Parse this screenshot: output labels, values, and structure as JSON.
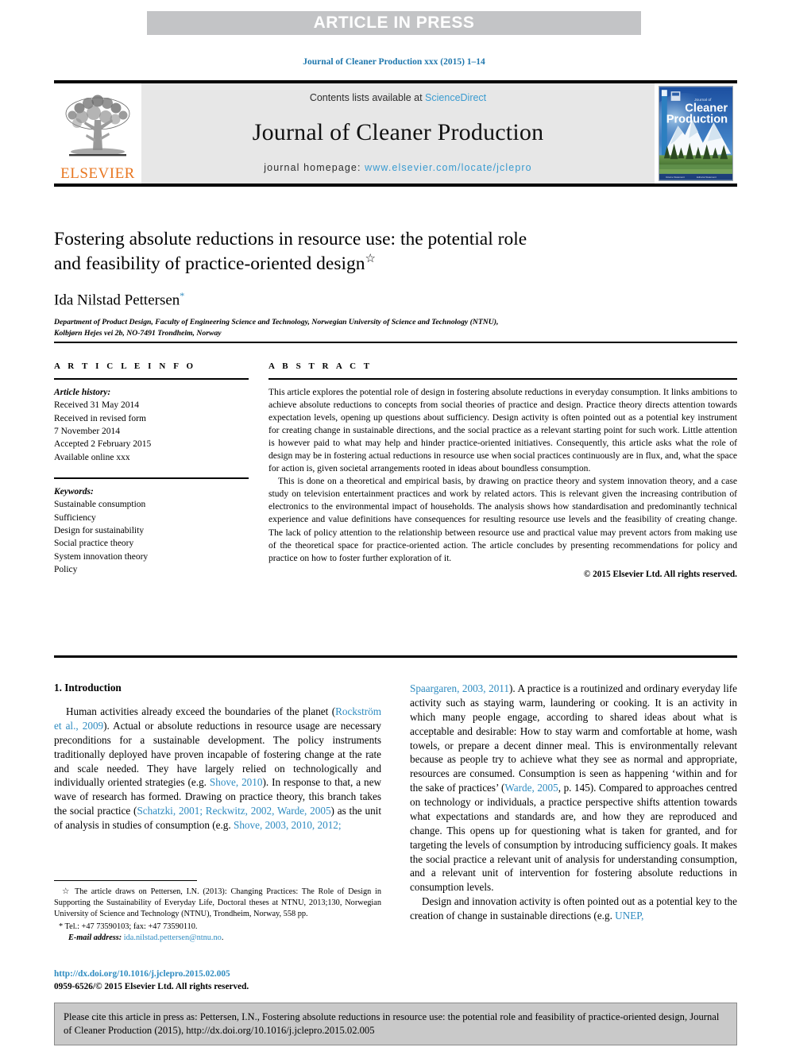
{
  "banner": {
    "label": "ARTICLE IN PRESS"
  },
  "journal_ref": "Journal of Cleaner Production xxx (2015) 1–14",
  "masthead": {
    "publisher_name": "ELSEVIER",
    "contents_prefix": "Contents lists available at ",
    "contents_link": "ScienceDirect",
    "journal_title": "Journal of Cleaner Production",
    "homepage_prefix": "journal homepage: ",
    "homepage_url": "www.elsevier.com/locate/jclepro",
    "cover": {
      "line1": "Journal of",
      "line2": "Cleaner",
      "line3": "Production"
    }
  },
  "title": {
    "line1": "Fostering absolute reductions in resource use: the potential role",
    "line2": "and feasibility of practice-oriented design",
    "footnote_mark": "☆"
  },
  "author": {
    "name": "Ida Nilstad Pettersen",
    "corresponding_mark": "*",
    "affiliation_line1": "Department of Product Design, Faculty of Engineering Science and Technology, Norwegian University of Science and Technology (NTNU),",
    "affiliation_line2": "Kolbjørn Hejes vei 2b, NO-7491 Trondheim, Norway"
  },
  "article_info": {
    "heading": "A R T I C L E  I N F O",
    "history_label": "Article history:",
    "history": [
      "Received 31 May 2014",
      "Received in revised form",
      "7 November 2014",
      "Accepted 2 February 2015",
      "Available online xxx"
    ],
    "keywords_label": "Keywords:",
    "keywords": [
      "Sustainable consumption",
      "Sufficiency",
      "Design for sustainability",
      "Social practice theory",
      "System innovation theory",
      "Policy"
    ]
  },
  "abstract": {
    "heading": "A B S T R A C T",
    "paragraph1": "This article explores the potential role of design in fostering absolute reductions in everyday consumption. It links ambitions to achieve absolute reductions to concepts from social theories of practice and design. Practice theory directs attention towards expectation levels, opening up questions about sufficiency. Design activity is often pointed out as a potential key instrument for creating change in sustainable directions, and the social practice as a relevant starting point for such work. Little attention is however paid to what may help and hinder practice-oriented initiatives. Consequently, this article asks what the role of design may be in fostering actual reductions in resource use when social practices continuously are in flux, and, what the space for action is, given societal arrangements rooted in ideas about boundless consumption.",
    "paragraph2": "This is done on a theoretical and empirical basis, by drawing on practice theory and system innovation theory, and a case study on television entertainment practices and work by related actors. This is relevant given the increasing contribution of electronics to the environmental impact of households. The analysis shows how standardisation and predominantly technical experience and value definitions have consequences for resulting resource use levels and the feasibility of creating change. The lack of policy attention to the relationship between resource use and practical value may prevent actors from making use of the theoretical space for practice-oriented action. The article concludes by presenting recommendations for policy and practice on how to foster further exploration of it.",
    "copyright": "© 2015 Elsevier Ltd. All rights reserved."
  },
  "body": {
    "section_title": "1.  Introduction",
    "left_col": {
      "p1_a": "Human activities already exceed the boundaries of the planet (",
      "p1_ref1": "Rockström et al., 2009",
      "p1_b": "). Actual or absolute reductions in resource usage are necessary preconditions for a sustainable development. The policy instruments traditionally deployed have proven incapable of fostering change at the rate and scale needed. They have largely relied on technologically and individually oriented strategies (e.g. ",
      "p1_ref2": "Shove, 2010",
      "p1_c": "). In response to that, a new wave of research has formed. Drawing on practice theory, this branch takes the social practice (",
      "p1_ref3": "Schatzki, 2001; Reckwitz, 2002, Warde, 2005",
      "p1_d": ") as the unit of analysis in studies of consumption (e.g. ",
      "p1_ref4": "Shove, 2003, 2010, 2012;"
    },
    "right_col": {
      "p1_ref_cont": "Spaargaren, 2003, 2011",
      "p1_a": "). A practice is a routinized and ordinary everyday life activity such as staying warm, laundering or cooking. It is an activity in which many people engage, according to shared ideas about what is acceptable and desirable: How to stay warm and comfortable at home, wash towels, or prepare a decent dinner meal. This is environmentally relevant because as people try to achieve what they see as normal and appropriate, resources are consumed. Consumption is seen as happening ‘within and for the sake of practices’ (",
      "p1_ref2": "Warde, 2005",
      "p1_b": ", p. 145). Compared to approaches centred on technology or individuals, a practice perspective shifts attention towards what expectations and standards are, and how they are reproduced and change. This opens up for questioning what is taken for granted, and for targeting the levels of consumption by introducing sufficiency goals. It makes the social practice a relevant unit of analysis for understanding consumption, and a relevant unit of intervention for fostering absolute reductions in consumption levels.",
      "p2_a": "Design and innovation activity is often pointed out as a potential key to the creation of change in sustainable directions (e.g. ",
      "p2_ref": "UNEP,"
    }
  },
  "footnotes": {
    "star": "☆",
    "star_text": "The article draws on Pettersen, I.N. (2013): Changing Practices: The Role of Design in Supporting the Sustainability of Everyday Life, Doctoral theses at NTNU, 2013;130, Norwegian University of Science and Technology (NTNU), Trondheim, Norway, 558 pp.",
    "tel_mark": "*",
    "tel_text": "Tel.: +47 73590103; fax: +47 73590110.",
    "email_label": "E-mail address:",
    "email": "ida.nilstad.pettersen@ntnu.no",
    "email_suffix": "."
  },
  "doi": {
    "link": "http://dx.doi.org/10.1016/j.jclepro.2015.02.005",
    "issn": "0959-6526/© 2015 Elsevier Ltd. All rights reserved."
  },
  "cite_box": {
    "text": "Please cite this article in press as: Pettersen, I.N., Fostering absolute reductions in resource use: the potential role and feasibility of practice-oriented design, Journal of Cleaner Production (2015), http://dx.doi.org/10.1016/j.jclepro.2015.02.005"
  },
  "colors": {
    "banner_gray": "#c3c4c6",
    "link_blue": "#2e8bc0",
    "elsevier_orange": "#e87722",
    "masthead_gray": "#e7e7e7",
    "cite_box_gray": "#c9c9c9"
  }
}
